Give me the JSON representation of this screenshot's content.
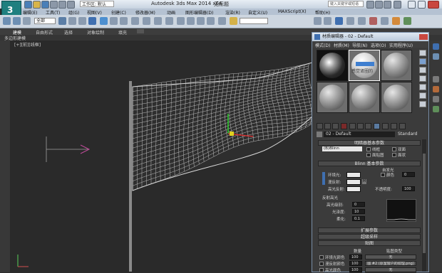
{
  "window": {
    "title": "Autodesk 3ds Max  2014 x64",
    "doc_name": "无标题",
    "workspace": "工作区: 默认",
    "search_placeholder": "键入关键字或短语"
  },
  "menubar": [
    "编辑(E)",
    "工具(T)",
    "组(G)",
    "视图(V)",
    "创建(C)",
    "修改器(M)",
    "动画",
    "图形编辑器(D)",
    "渲染(R)",
    "自定义(U)",
    "MAXScript(X)",
    "帮助(H)"
  ],
  "toolbar": {
    "selection_filter": "全部"
  },
  "ribbon": {
    "tabs": [
      "建模",
      "自由形式",
      "选择",
      "对象绘制",
      "填充"
    ],
    "sub": "多边形建模"
  },
  "viewport": {
    "label": "[+][前][线框]"
  },
  "material_editor": {
    "title": "材质编辑器 - 02 - Default",
    "menu": [
      "模式(D)",
      "材质(M)",
      "导航(N)",
      "选项(O)",
      "实用程序(U)"
    ],
    "sample_caption": "感觉肾圈的",
    "material_name": "02 - Default",
    "material_type": "Standard",
    "rollouts": {
      "shader_basic": "明暗器基本参数",
      "blinn_basic": "Blinn 基本参数",
      "extended": "扩展参数",
      "supersampling": "超级采样",
      "maps": "贴图"
    },
    "shader": {
      "type": "(B)Blinn",
      "wire": "线框",
      "two_sided": "双面",
      "face_map": "面贴图",
      "faceted": "面状"
    },
    "blinn": {
      "self_illum": "自发光",
      "color_label": "颜色",
      "color_value": "0",
      "ambient": "环境光:",
      "diffuse": "漫反射:",
      "specular": "高光反射:",
      "opacity_label": "不透明度:",
      "opacity_value": "100"
    },
    "spec_highlights": {
      "title": "反射高光",
      "level_label": "高光级别:",
      "level_value": "0",
      "gloss_label": "光泽度:",
      "gloss_value": "10",
      "soften_label": "柔化:",
      "soften_value": "0.1"
    },
    "maps": {
      "amount_header": "数量",
      "type_header": "贴图类型",
      "rows": [
        {
          "label": "环境光颜色",
          "amount": "100",
          "map": "无"
        },
        {
          "label": "漫反射颜色",
          "amount": "100",
          "map": "图 #2 (原室窗户的纹理.png)"
        },
        {
          "label": "高光颜色",
          "amount": "100",
          "map": "无"
        }
      ]
    }
  },
  "colors": {
    "titlebar": "#c7d3e0",
    "viewport_bg": "#2a2a2a",
    "wireframe": "#d8d8d8",
    "panel_bg": "#3b3b3b"
  }
}
